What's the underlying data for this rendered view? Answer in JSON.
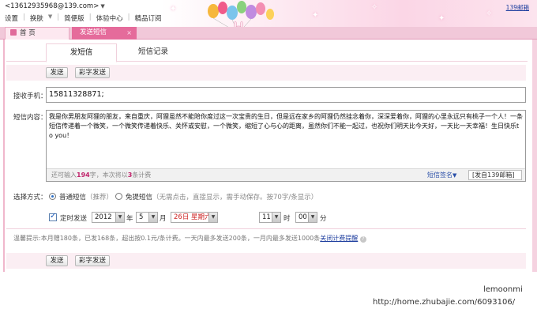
{
  "header": {
    "account": "<13612935968@139.com>",
    "menu": [
      "设置",
      "换肤",
      "简便版",
      "体验中心",
      "精品订阅"
    ],
    "mail_link": "139邮箱"
  },
  "tabs": {
    "home": "首 页",
    "send_sms": "发送短信",
    "close": "×"
  },
  "subtabs": {
    "send": "发短信",
    "records": "短信记录"
  },
  "buttons": {
    "send": "发送",
    "color_send": "彩字发送"
  },
  "form": {
    "receiver_label": "接收手机：",
    "receiver_value": "15811328871;",
    "content_label": "短信内容：",
    "content_text": "我是你男朋友阿狸的朋友，来自重庆，阿狸虽然不能陪你度过这一次宝贵的生日，但是远在家乡的阿狸仍然挂念着你，深深爱着你，阿狸的心里永远只有桃子一个人！一条短信传递着一个微笑，一个微笑传递着快乐、关怀或安慰，一个微笑，缩短了心与心的距离，虽然你们不能一起过，也祝你们明天比今天好，一天比一天幸福！生日快乐to you！",
    "counter_prefix": "还可输入",
    "counter_count": "194",
    "counter_mid": "字，本次将以",
    "counter_num": "3",
    "counter_suffix": "条计费",
    "signature": "短信签名",
    "suffix": "[发自139邮箱]",
    "method_label": "选择方式：",
    "method_normal": "普通短信",
    "method_normal_note": "（推荐）",
    "method_free": "免提短信",
    "method_free_note": "（无需点击，直接显示，需手动保存。按70字/条显示）",
    "timed_label": "定时发送",
    "year": "2012",
    "year_unit": "年",
    "month": "5",
    "month_unit": "月",
    "day": "26日 星期六",
    "day_unit": "日",
    "hour": "11",
    "hour_unit": "时",
    "minute": "00",
    "minute_unit": "分"
  },
  "tip": {
    "text": "温馨提示:本月赠180条，已发168条，超出按0.1元/条计费。一天内最多发送200条，一月内最多发送1000条",
    "link": "关闭计费提醒"
  },
  "watermark": {
    "line1": "lemoonmi",
    "line2": "http://home.zhubajie.com/6093106/"
  }
}
